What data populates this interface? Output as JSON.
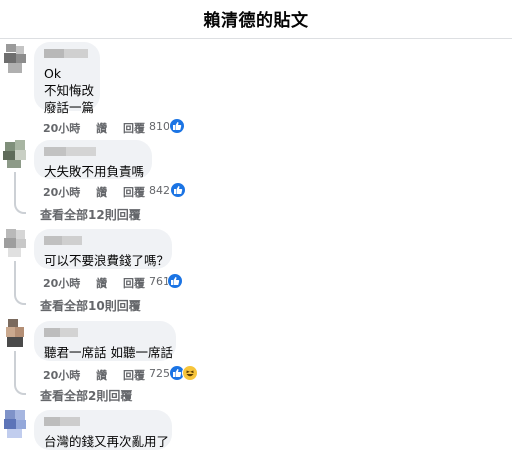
{
  "header": {
    "title": "賴清德的貼文"
  },
  "colors": {
    "like_blue": "#1b74e4",
    "bubble_bg": "#f0f2f5",
    "meta_gray": "#65676b"
  },
  "comments": [
    {
      "text_lines": [
        "Ok",
        "不知悔改",
        "廢話一篇"
      ],
      "time": "20小時",
      "like_label": "讚",
      "reply_label": "回覆",
      "reactions": "810",
      "reaction_icons": [
        "like-icon"
      ]
    },
    {
      "text_lines": [
        "大失敗不用負責嗎"
      ],
      "time": "20小時",
      "like_label": "讚",
      "reply_label": "回覆",
      "reactions": "842",
      "reaction_icons": [
        "like-icon"
      ],
      "view_replies": "查看全部12則回覆"
    },
    {
      "text_lines": [
        "可以不要浪費錢了嗎？"
      ],
      "time": "20小時",
      "like_label": "讚",
      "reply_label": "回覆",
      "reactions": "761",
      "reaction_icons": [
        "like-icon"
      ],
      "view_replies": "查看全部10則回覆"
    },
    {
      "text_lines": [
        "聽君一席話 如聽一席話"
      ],
      "time": "20小時",
      "like_label": "讚",
      "reply_label": "回覆",
      "reactions": "725",
      "reaction_icons": [
        "like-icon",
        "haha-icon"
      ],
      "view_replies": "查看全部2則回覆"
    },
    {
      "text_lines": [
        "台灣的錢又再次亂用了"
      ]
    }
  ]
}
